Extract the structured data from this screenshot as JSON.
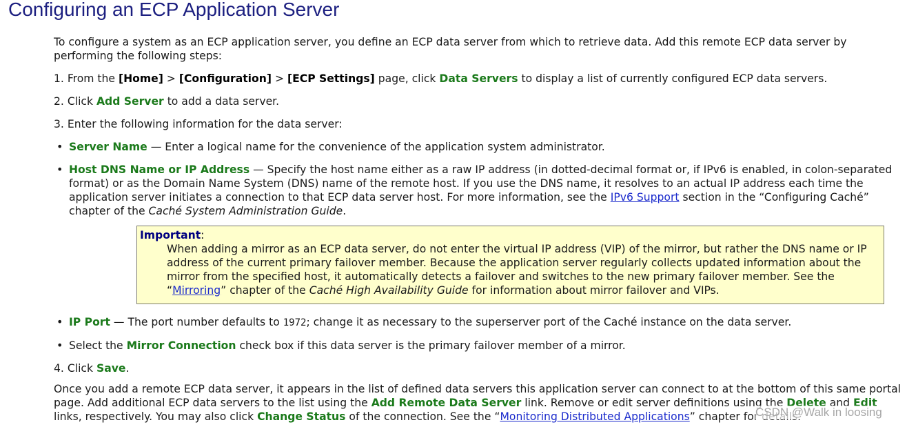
{
  "title": "Configuring an ECP Application Server",
  "intro": "To configure a system as an ECP application server, you define an ECP data server from which to retrieve data. Add this remote ECP data server by performing the following steps:",
  "step1": {
    "num": "1. ",
    "prefix": "From the ",
    "home": "[Home]",
    "sep1": " > ",
    "config": "[Configuration]",
    "sep2": " > ",
    "ecp": "[ECP Settings]",
    "mid": " page, click ",
    "link": "Data Servers",
    "suffix": " to display a list of currently configured ECP data servers."
  },
  "step2": {
    "num": "2. ",
    "prefix": "Click ",
    "link": "Add Server",
    "suffix": " to add a data server."
  },
  "step3": {
    "text": "3. Enter the following information for the data server:"
  },
  "bullet1": {
    "term": "Server Name",
    "text": " — Enter a logical name for the convenience of the application system administrator."
  },
  "bullet2": {
    "term": "Host DNS Name or IP Address",
    "text1": " — Specify the host name either as a raw IP address (in dotted-decimal format or, if IPv6 is enabled, in colon-separated format) or as the Domain Name System (DNS) name of the remote host. If you use the DNS name, it resolves to an actual IP address each time the application server initiates a connection to that ECP data server host. For more information, see the ",
    "link": "IPv6 Support",
    "text2": " section in the “Configuring Caché” chapter of the ",
    "italic": "Caché System Administration Guide",
    "text3": "."
  },
  "important": {
    "label": "Important",
    "colon": ":",
    "text1": "When adding a mirror as an ECP data server, do not enter the virtual IP address (VIP) of the mirror, but rather the DNS name or IP address of the current primary failover member. Because the application server regularly collects updated information about the mirror from the specified host, it automatically detects a failover and switches to the new primary failover member. See the “",
    "link": "Mirroring",
    "text2": "” chapter of the ",
    "italic": "Caché High Availability Guide",
    "text3": " for information about mirror failover and VIPs."
  },
  "bullet3": {
    "term": "IP Port",
    "text1": " — The port number defaults to ",
    "code": "1972",
    "text2": "; change it as necessary to the superserver port of the Caché instance on the data server."
  },
  "bullet4": {
    "prefix": "Select the ",
    "term": "Mirror Connection",
    "suffix": " check box if this data server is the primary failover member of a mirror."
  },
  "step4": {
    "num": "4. ",
    "prefix": "Click ",
    "link": "Save",
    "suffix": "."
  },
  "outro": {
    "text1": "Once you add a remote ECP data server, it appears in the list of defined data servers this application server can connect to at the bottom of this same portal page. Add additional ECP data servers to the list using the ",
    "link1": "Add Remote Data Server",
    "text2": " link. Remove or edit server definitions using the ",
    "link2": "Delete",
    "text3": " and ",
    "link3": "Edit",
    "text4": " links, respectively. You may also click ",
    "link4": "Change Status",
    "text5": " of the connection. See the “",
    "link5": "Monitoring Distributed Applications",
    "text6": "” chapter for details."
  },
  "watermark": "CSDN @Walk in loosing",
  "colors": {
    "title": "#1c1f80",
    "accent_green": "#1b7a1b",
    "link": "#1a2acc",
    "important_bg": "#ffffcc"
  }
}
